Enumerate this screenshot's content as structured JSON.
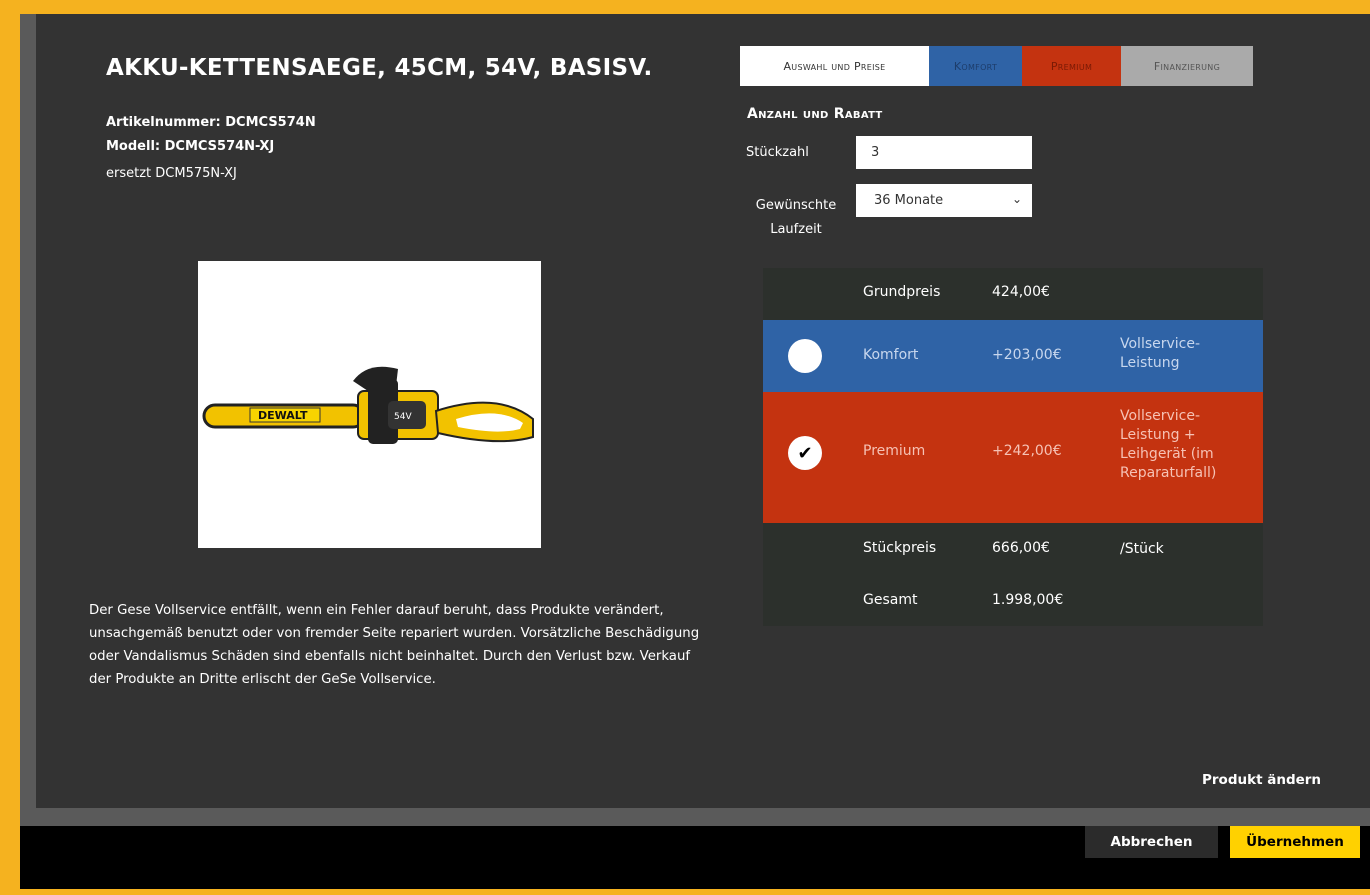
{
  "product": {
    "title": "AKKU-KETTENSAEGE, 45CM, 54V, BASISV.",
    "article_number": "Artikelnummer: DCMCS574N",
    "model": "Modell: DCMCS574N-XJ",
    "replaces": "ersetzt DCM575N-XJ",
    "image_alt": "DeWALT 54V chainsaw",
    "brand_mark": "DEWALT",
    "battery_mark": "54V",
    "disclaimer": "Der Gese Vollservice entfällt, wenn ein Fehler darauf beruht, dass Produkte verändert, unsachgemäß benutzt oder von fremder Seite repariert wurden. Vorsätzliche Beschädigung oder Vandalismus Schäden sind ebenfalls nicht beinhaltet. Durch den Verlust bzw. Verkauf der Produkte an Dritte erlischt der GeSe Vollservice."
  },
  "tabs": [
    {
      "label": "Auswahl und Preise"
    },
    {
      "label": "Komfort"
    },
    {
      "label": "Premium"
    },
    {
      "label": "Finanzierung"
    }
  ],
  "config": {
    "section_title": "Anzahl und Rabatt",
    "quantity_label": "Stückzahl",
    "quantity_value": "3",
    "term_label": "Gewünschte Laufzeit",
    "term_value": "36 Monate"
  },
  "prices": {
    "base": {
      "name": "Grundpreis",
      "value": "424,00€"
    },
    "komfort": {
      "name": "Komfort",
      "value": "+203,00€",
      "note": "Vollservice-Leistung",
      "selected": false
    },
    "premium": {
      "name": "Premium",
      "value": "+242,00€",
      "note": "Vollservice-Leistung + Leihgerät (im Reparaturfall)",
      "selected": true
    },
    "unit": {
      "name": "Stückpreis",
      "value": "666,00€",
      "suffix": "/Stück"
    },
    "total": {
      "name": "Gesamt",
      "value": "1.998,00€"
    }
  },
  "actions": {
    "change_product": "Produkt ändern",
    "cancel": "Abbrechen",
    "apply": "Übernehmen"
  },
  "colors": {
    "border_accent": "#f5b21f",
    "komfort": "#2f63a6",
    "premium": "#c43310",
    "apply_button": "#ffd100"
  }
}
